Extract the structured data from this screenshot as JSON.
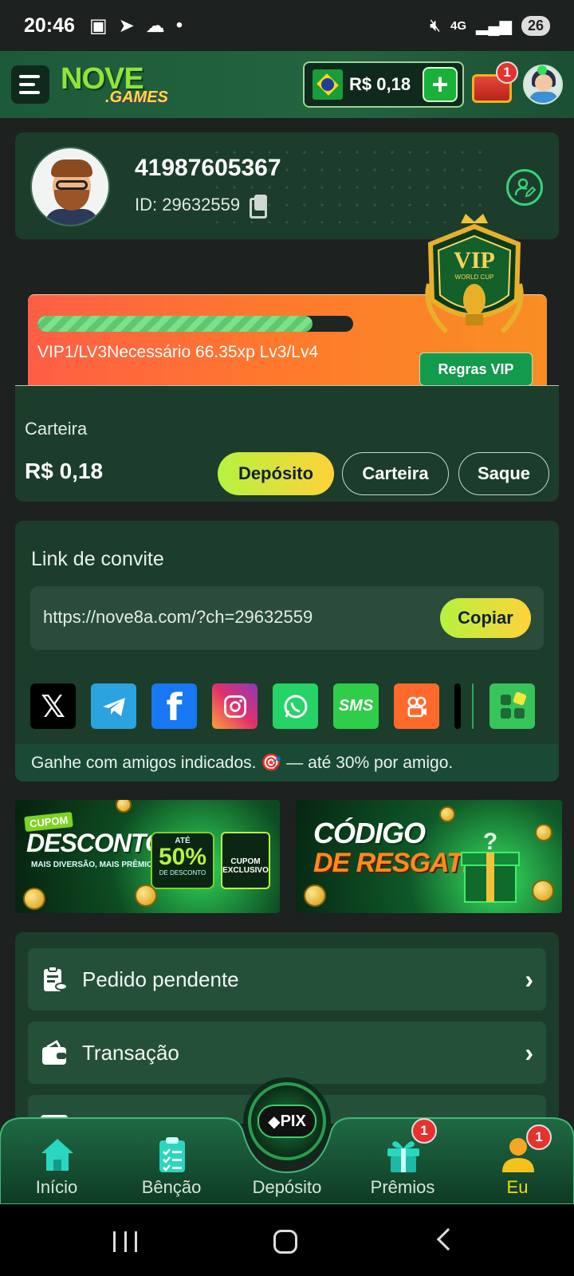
{
  "status_bar": {
    "time": "20:46",
    "network": "4G",
    "battery": "26"
  },
  "header": {
    "logo_top": "NOVE",
    "logo_bottom": ".GAMES",
    "balance": "R$ 0,18",
    "chest_badge": "1"
  },
  "profile": {
    "username": "41987605367",
    "id_label": "ID: 29632559"
  },
  "vip": {
    "progress": 0.87,
    "status_text": "VIP1/LV3Necessário 66.35xp Lv3/Lv4",
    "rules_button": "Regras VIP",
    "badge_title": "VIP",
    "badge_sub": "WORLD CUP"
  },
  "wallet": {
    "label": "Carteira",
    "amount": "R$ 0,18",
    "deposit_button": "Depósito",
    "wallet_button": "Carteira",
    "withdraw_button": "Saque"
  },
  "invite": {
    "title": "Link de convite",
    "link": "https://nove8a.com/?ch=29632559",
    "copy_button": "Copiar",
    "share_icons": [
      "x-icon",
      "telegram-icon",
      "facebook-icon",
      "instagram-icon",
      "whatsapp-icon",
      "sms-icon",
      "kwai-icon",
      "more-apps-icon"
    ],
    "footer": "Ganhe com amigos indicados. 🎯 — até 30% por amigo."
  },
  "banners": {
    "b1_tag": "CUPOM",
    "b1_title": "DESCONTO",
    "b1_sub": "MAIS DIVERSÃO, MAIS PRÊMIOS!",
    "b1_ate": "ATÉ",
    "b1_pct": "50%",
    "b1_dd": "DE DESCONTO",
    "b1_coupon": "CUPOM EXCLUSIVO",
    "b2_line1": "CÓDIGO",
    "b2_line2": "DE RESGATE"
  },
  "menu": {
    "items": [
      {
        "label": "Pedido pendente",
        "icon": "clipboard-coins-icon"
      },
      {
        "label": "Transação",
        "icon": "wallet-icon"
      }
    ]
  },
  "bottom_nav": {
    "items": [
      {
        "label": "Início",
        "icon": "home-icon"
      },
      {
        "label": "Bênção",
        "icon": "checklist-icon"
      },
      {
        "label": "Depósito",
        "icon": "pix-icon"
      },
      {
        "label": "Prêmios",
        "icon": "gift-icon",
        "badge": "1"
      },
      {
        "label": "Eu",
        "icon": "user-icon",
        "badge": "1"
      }
    ],
    "pix_label": "PIX",
    "active_color": "#f5d90a"
  }
}
